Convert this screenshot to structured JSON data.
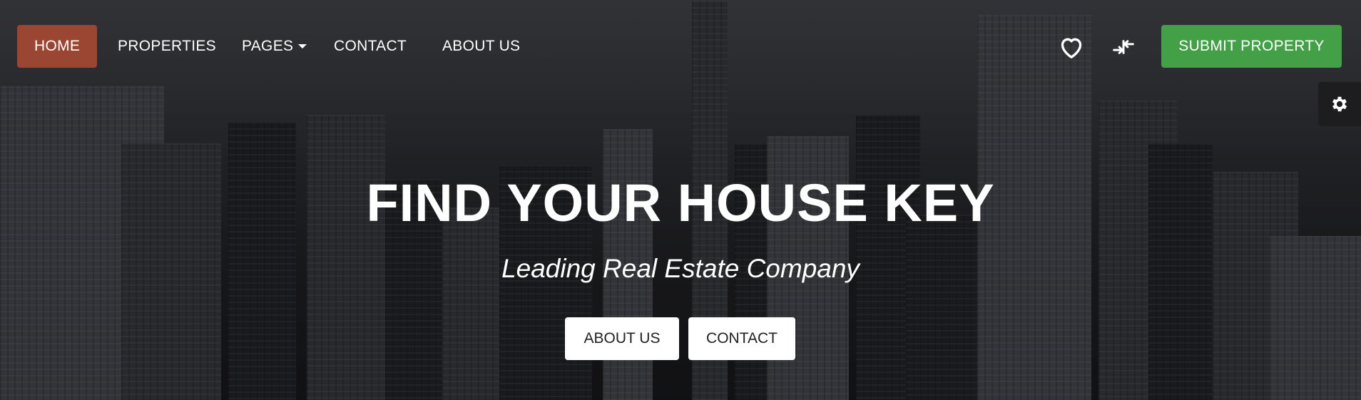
{
  "nav": {
    "items": [
      {
        "label": "HOME",
        "active": true
      },
      {
        "label": "PROPERTIES"
      },
      {
        "label": "PAGES",
        "has_dropdown": true
      },
      {
        "label": "CONTACT"
      },
      {
        "label": "ABOUT US"
      }
    ],
    "icons": {
      "favorites": "heart-icon",
      "compare": "compare-arrows-icon"
    },
    "submit_label": "SUBMIT PROPERTY"
  },
  "settings": {
    "icon": "gear-icon"
  },
  "hero": {
    "title": "FIND YOUR HOUSE KEY",
    "subtitle": "Leading Real Estate Company",
    "buttons": [
      {
        "label": "ABOUT US"
      },
      {
        "label": "CONTACT"
      }
    ]
  },
  "colors": {
    "home_active": "#9b4632",
    "submit": "#43a047",
    "settings_tab": "#1d1d1f",
    "text": "#ffffff"
  }
}
